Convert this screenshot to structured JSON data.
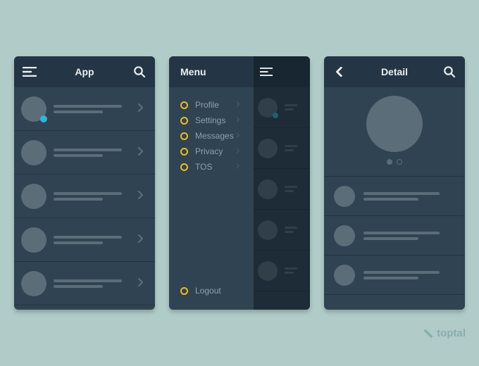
{
  "phones": {
    "app": {
      "title": "App",
      "rows": [
        {
          "hasDot": true
        },
        {
          "hasDot": false
        },
        {
          "hasDot": false
        },
        {
          "hasDot": false
        },
        {
          "hasDot": false
        }
      ]
    },
    "menu": {
      "title": "Menu",
      "items": [
        {
          "label": "Profile"
        },
        {
          "label": "Settings"
        },
        {
          "label": "Messages"
        },
        {
          "label": "Privacy"
        },
        {
          "label": "TOS"
        }
      ],
      "footer": {
        "label": "Logout"
      }
    },
    "detail": {
      "title": "Detail"
    }
  },
  "watermark": "toptal"
}
